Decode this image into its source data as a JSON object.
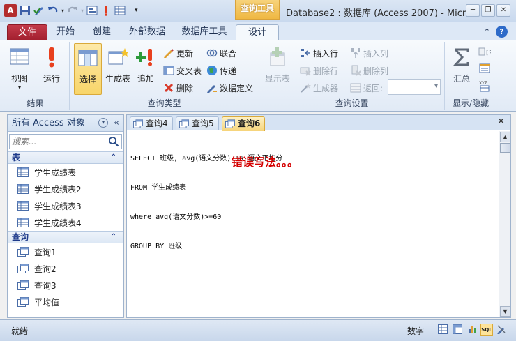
{
  "window": {
    "title": "Database2 : 数据库 (Access 2007) - Micro...",
    "context_tab_title": "查询工具"
  },
  "ribbon_tabs": [
    "文件",
    "开始",
    "创建",
    "外部数据",
    "数据库工具",
    "设计"
  ],
  "ribbon": {
    "groups": {
      "results": "结果",
      "query_type": "查询类型",
      "query_setup": "查询设置",
      "show_hide": "显示/隐藏"
    },
    "buttons": {
      "view": "视图",
      "run": "运行",
      "select": "选择",
      "make_table": "生成表",
      "append": "追加",
      "update": "更新",
      "crosstab": "交叉表",
      "delete": "删除",
      "union": "联合",
      "pass_through": "传递",
      "data_definition": "数据定义",
      "show_table": "显示表",
      "insert_rows": "插入行",
      "delete_rows": "删除行",
      "builder": "生成器",
      "insert_columns": "插入列",
      "delete_columns": "删除列",
      "return": "返回:",
      "totals": "汇总"
    }
  },
  "nav": {
    "header": "所有 Access 对象",
    "search_placeholder": "搜索...",
    "categories": [
      {
        "label": "表",
        "items": [
          "学生成绩表",
          "学生成绩表2",
          "学生成绩表3",
          "学生成绩表4"
        ]
      },
      {
        "label": "查询",
        "items": [
          "查询1",
          "查询2",
          "查询3",
          "平均值"
        ]
      }
    ]
  },
  "doc_tabs": [
    "查询4",
    "查询5",
    "查询6"
  ],
  "active_tab": "查询6",
  "sql": {
    "line1": "SELECT 班级, avg(语文分数) as 语文平均分",
    "line2": "FROM 学生成绩表",
    "line3": "where avg(语文分数)>=60",
    "line4": "GROUP BY 班级",
    "annotation": "错误写法。。。"
  },
  "status": {
    "left": "就绪",
    "mode": "数字",
    "view_sql": "SQL"
  }
}
